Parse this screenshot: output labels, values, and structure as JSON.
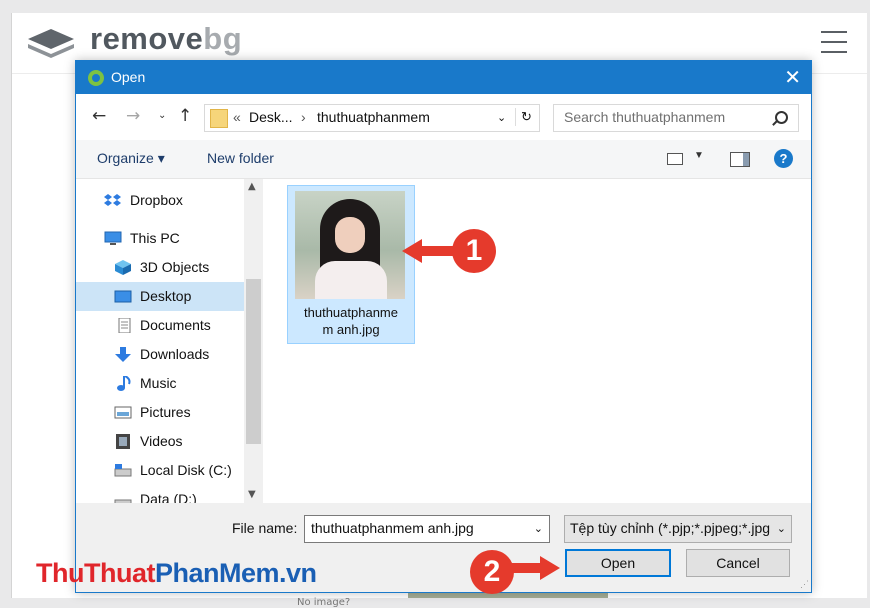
{
  "app": {
    "logo_main": "remove",
    "logo_suffix": "bg",
    "background_caption": "No image?"
  },
  "dialog": {
    "title": "Open",
    "close_glyph": "✕",
    "address": {
      "overflow": "«",
      "crumb1": "Desk...",
      "sep": "›",
      "crumb2": "thuthuatphanmem"
    },
    "search_placeholder": "Search thuthuatphanmem",
    "toolbar": {
      "organize": "Organize ▾",
      "new_folder": "New folder",
      "help": "?"
    },
    "nav": [
      {
        "label": "Dropbox",
        "icon": "dropbox-icon"
      },
      {
        "label": "This PC",
        "icon": "pc-icon"
      },
      {
        "label": "3D Objects",
        "icon": "cube-icon"
      },
      {
        "label": "Desktop",
        "icon": "desktop-icon",
        "selected": true
      },
      {
        "label": "Documents",
        "icon": "document-icon"
      },
      {
        "label": "Downloads",
        "icon": "download-icon"
      },
      {
        "label": "Music",
        "icon": "music-icon"
      },
      {
        "label": "Pictures",
        "icon": "pictures-icon"
      },
      {
        "label": "Videos",
        "icon": "video-icon"
      },
      {
        "label": "Local Disk (C:)",
        "icon": "disk-icon"
      },
      {
        "label": "Data (D:)",
        "icon": "disk-icon"
      }
    ],
    "file": {
      "line1": "thuthuatphanme",
      "line2": "m anh.jpg"
    },
    "filename_label": "File name:",
    "filename_value": "thuthuatphanmem anh.jpg",
    "filetype": "Tệp tùy chỉnh (*.pjp;*.pjpeg;*.jpg",
    "open_label": "Open",
    "cancel_label": "Cancel"
  },
  "annotations": {
    "step1": "1",
    "step2": "2",
    "accent": "#e53a2c"
  },
  "watermark": {
    "part1": "Thu",
    "part2": "Thuat",
    "part3": "Phan",
    "part4": "Mem",
    "part5": ".vn",
    "color_red": "#e0262b",
    "color_blue": "#1a5fb4"
  }
}
